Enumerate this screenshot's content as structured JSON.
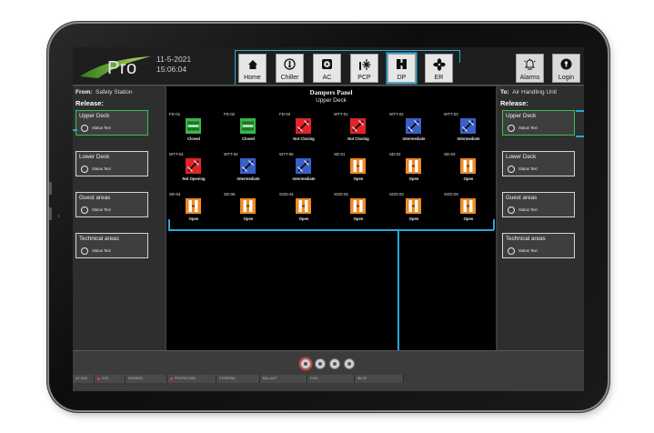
{
  "header": {
    "logo_text": "Pro",
    "date": "11-5-2021",
    "time": "15:06:04",
    "nav": [
      {
        "label": "Home",
        "icon": "home-icon"
      },
      {
        "label": "Chiller",
        "icon": "thermometer-icon"
      },
      {
        "label": "AC",
        "icon": "ac-unit-icon"
      },
      {
        "label": "PCP",
        "icon": "snowflake-icon"
      },
      {
        "label": "DP",
        "icon": "damper-icon"
      },
      {
        "label": "ER",
        "icon": "fan-icon"
      }
    ],
    "alarms_label": "Alarms",
    "login_label": "Login",
    "accent": "#29a7d8"
  },
  "left_panel": {
    "from_label": "From:",
    "from_value": "Safety Station",
    "release_label": "Release:",
    "areas": [
      {
        "title": "Upper Deck",
        "status": "Status Text"
      },
      {
        "title": "Lower Deck",
        "status": "Status Text"
      },
      {
        "title": "Guest areas",
        "status": "Status Text"
      },
      {
        "title": "Technical areas",
        "status": "Status Text"
      }
    ]
  },
  "right_panel": {
    "to_label": "To:",
    "to_value": "Air Handling Unit",
    "release_label": "Release:",
    "areas": [
      {
        "title": "Upper Deck",
        "status": "Status Text"
      },
      {
        "title": "Lower Deck",
        "status": "Status Text"
      },
      {
        "title": "Guest areas",
        "status": "Status Text"
      },
      {
        "title": "Technical areas",
        "status": "Status Text"
      }
    ]
  },
  "center": {
    "title": "Dampers Panel",
    "subtitle": "Upper Deck",
    "dampers": [
      {
        "id": "FD-01",
        "status": "Closed",
        "color": "#3cb449",
        "kind": "closed"
      },
      {
        "id": "FD-02",
        "status": "Closed",
        "color": "#3cb449",
        "kind": "closed"
      },
      {
        "id": "FD-03",
        "status": "Not Closing",
        "color": "#e0242a",
        "kind": "fault"
      },
      {
        "id": "WTT-01",
        "status": "Not Closing",
        "color": "#e0242a",
        "kind": "fault"
      },
      {
        "id": "WTT-02",
        "status": "Intermediate",
        "color": "#3a5fc8",
        "kind": "inter"
      },
      {
        "id": "WTT-03",
        "status": "Intermediate",
        "color": "#3a5fc8",
        "kind": "inter"
      },
      {
        "id": "WTT-04",
        "status": "Not Opening",
        "color": "#e0242a",
        "kind": "fault"
      },
      {
        "id": "WTT-04",
        "status": "Intermediate",
        "color": "#3a5fc8",
        "kind": "inter"
      },
      {
        "id": "WTT-05",
        "status": "Intermediate",
        "color": "#3a5fc8",
        "kind": "inter"
      },
      {
        "id": "SD-01",
        "status": "Open",
        "color": "#f08a24",
        "kind": "open"
      },
      {
        "id": "SD-02",
        "status": "Open",
        "color": "#f08a24",
        "kind": "open"
      },
      {
        "id": "SD-03",
        "status": "Open",
        "color": "#f08a24",
        "kind": "open"
      },
      {
        "id": "SD-04",
        "status": "Open",
        "color": "#f08a24",
        "kind": "open"
      },
      {
        "id": "SD-06",
        "status": "Open",
        "color": "#f08a24",
        "kind": "open"
      },
      {
        "id": "SOD-01",
        "status": "Open",
        "color": "#f08a24",
        "kind": "open"
      },
      {
        "id": "SOD-02",
        "status": "Open",
        "color": "#f08a24",
        "kind": "open"
      },
      {
        "id": "SOD-03",
        "status": "Open",
        "color": "#f08a24",
        "kind": "open"
      },
      {
        "id": "SOD-04",
        "status": "Open",
        "color": "#f08a24",
        "kind": "open"
      }
    ]
  },
  "bottom": {
    "tabs": [
      "AC DAS",
      "DCS",
      "ENGINES",
      "PROPULSION",
      "STEERING",
      "BALLAST",
      "FUEL",
      "BILGE"
    ]
  }
}
